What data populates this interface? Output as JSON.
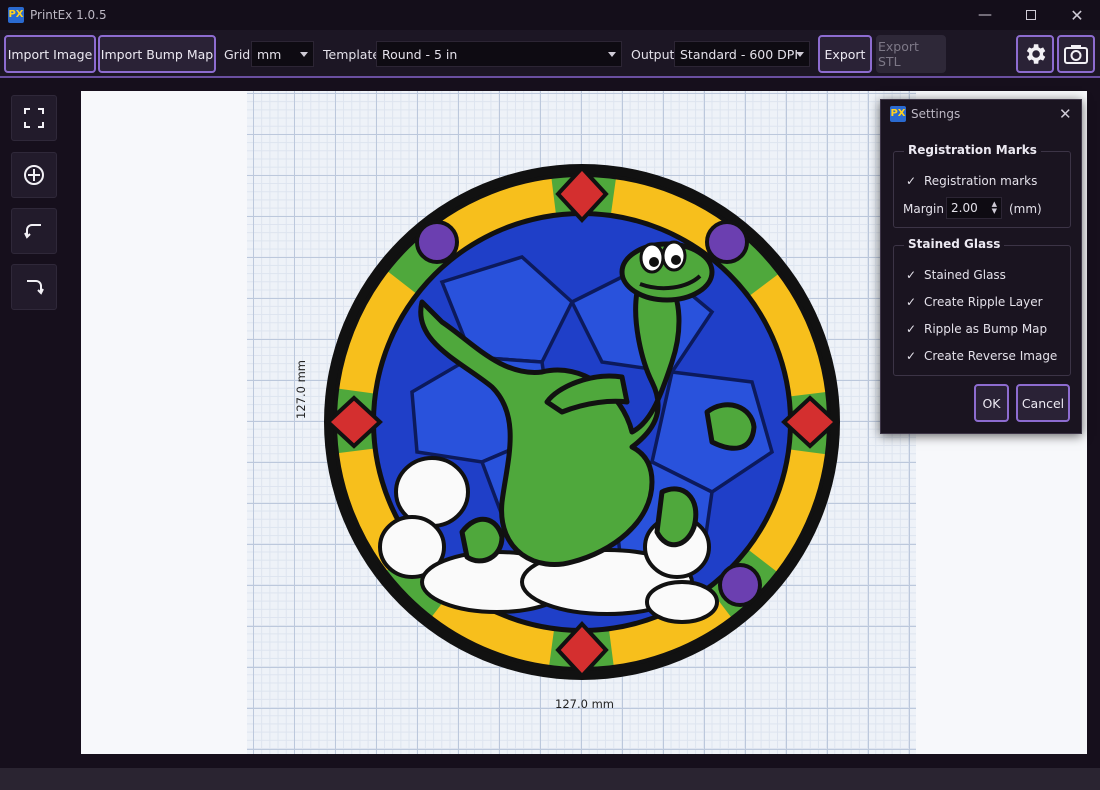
{
  "app": {
    "title": "PrintEx 1.0.5",
    "logo_text": "PX"
  },
  "toolbar": {
    "import_image": "Import Image",
    "import_bump_map": "Import Bump Map",
    "grid_label": "Grid",
    "grid_value": "mm",
    "template_label": "Template",
    "template_value": "Round - 5 in",
    "output_label": "Output",
    "output_value": "Standard - 600 DPI",
    "export": "Export",
    "export_stl": "Export STL"
  },
  "canvas": {
    "width_label": "127.0 mm",
    "height_label": "127.0 mm"
  },
  "settings": {
    "title": "Settings",
    "registration_group": "Registration Marks",
    "registration_marks": "Registration marks",
    "margin_label": "Margin",
    "margin_value": "2.00",
    "margin_unit": "(mm)",
    "stained_group": "Stained Glass",
    "stained_glass": "Stained Glass",
    "ripple_layer": "Create Ripple Layer",
    "ripple_bump": "Ripple as Bump Map",
    "reverse_image": "Create Reverse Image",
    "check_mark": "✓",
    "ok": "OK",
    "cancel": "Cancel"
  },
  "colors": {
    "accent": "#8d6cd0",
    "glass_blue": "#1f3fc8",
    "glass_green": "#4fa83c",
    "glass_yellow": "#f7bf1c",
    "glass_red": "#d42f2f",
    "glass_purple": "#6b3fb0"
  }
}
